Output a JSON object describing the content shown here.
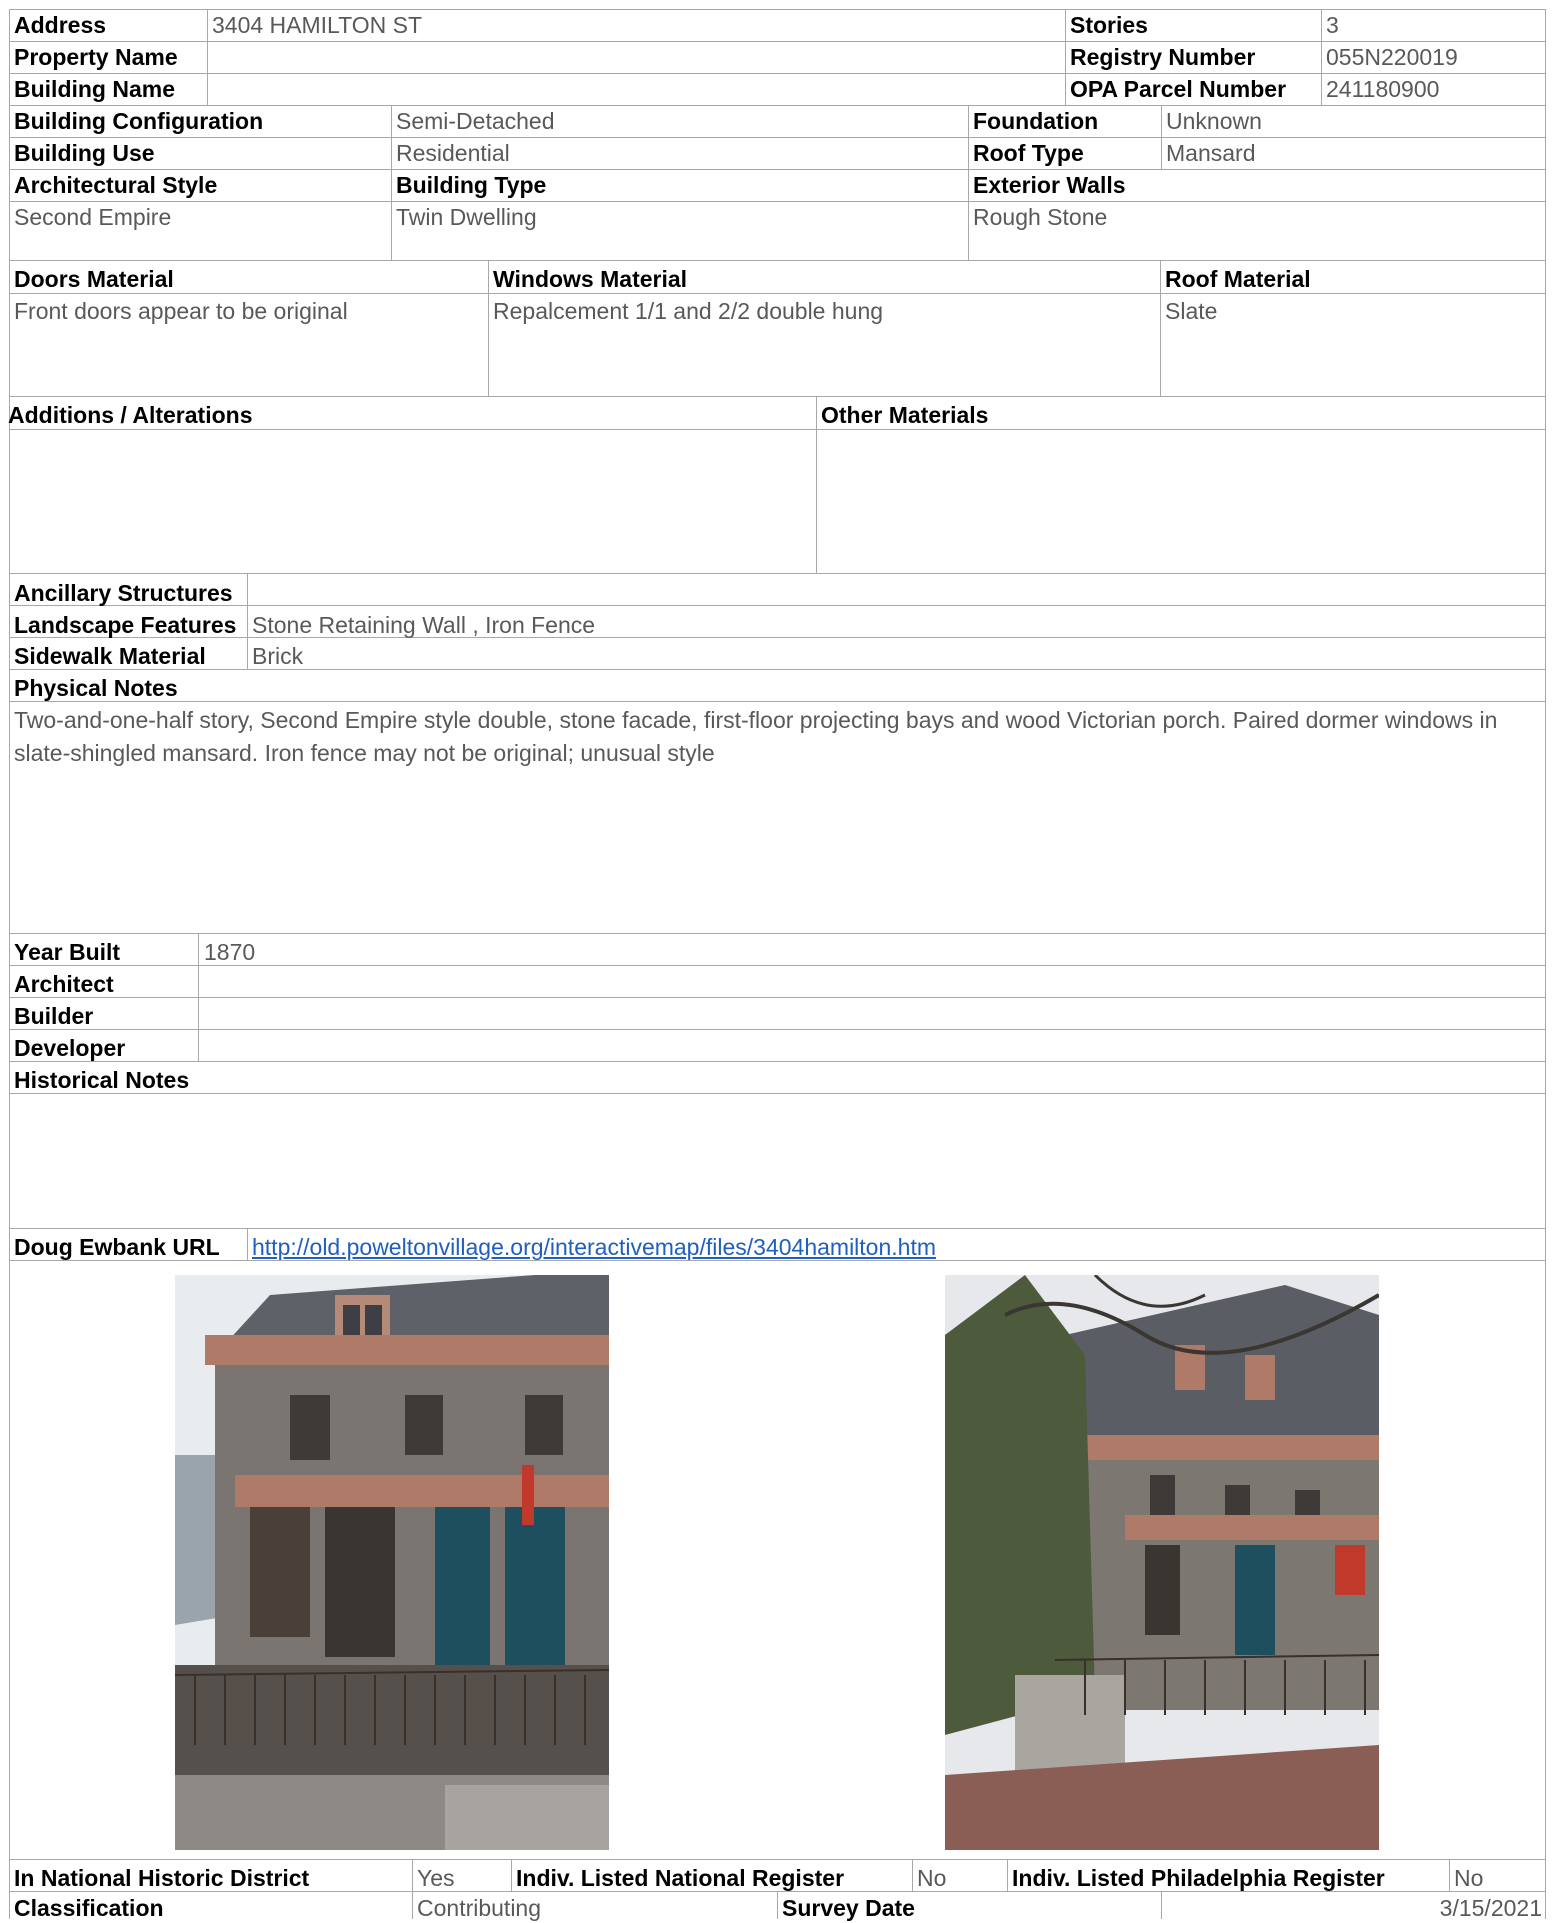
{
  "identity": {
    "address_label": "Address",
    "address_value": "3404 HAMILTON ST",
    "property_name_label": "Property Name",
    "property_name_value": "",
    "building_name_label": "Building Name",
    "building_name_value": "",
    "stories_label": "Stories",
    "stories_value": "3",
    "registry_label": "Registry Number",
    "registry_value": "055N220019",
    "opa_label": "OPA Parcel Number",
    "opa_value": "241180900"
  },
  "building": {
    "config_label": "Building Configuration",
    "config_value": "Semi-Detached",
    "use_label": "Building Use",
    "use_value": "Residential",
    "foundation_label": "Foundation",
    "foundation_value": "Unknown",
    "roof_type_label": "Roof Type",
    "roof_type_value": "Mansard",
    "style_label": "Architectural Style",
    "style_value": "Second Empire",
    "type_label": "Building Type",
    "type_value": "Twin Dwelling",
    "walls_label": "Exterior Walls",
    "walls_value": "Rough Stone"
  },
  "materials": {
    "doors_label": "Doors Material",
    "doors_value": "Front doors appear to be original",
    "windows_label": "Windows Material",
    "windows_value": "Repalcement 1/1 and 2/2 double hung",
    "roof_label": "Roof Material",
    "roof_value": "Slate",
    "additions_label": "Additions / Alterations",
    "additions_value": "",
    "other_label": "Other Materials",
    "other_value": ""
  },
  "site": {
    "ancillary_label": "Ancillary Structures",
    "ancillary_value": "",
    "landscape_label": "Landscape Features",
    "landscape_value": "Stone Retaining Wall , Iron Fence",
    "sidewalk_label": "Sidewalk Material",
    "sidewalk_value": "Brick",
    "physical_label": "Physical Notes",
    "physical_value": "Two-and-one-half story, Second Empire style double, stone facade, first-floor projecting bays and wood Victorian porch. Paired dormer windows in slate-shingled mansard. Iron fence may not be original; unusual style"
  },
  "history": {
    "year_label": "Year Built",
    "year_value": "1870",
    "architect_label": "Architect",
    "architect_value": "",
    "builder_label": "Builder",
    "builder_value": "",
    "developer_label": "Developer",
    "developer_value": "",
    "notes_label": "Historical Notes",
    "notes_value": "",
    "url_label": "Doug Ewbank URL",
    "url_value": "http://old.poweltonvillage.org/interactivemap/files/3404hamilton.htm"
  },
  "status": {
    "district_label": "In National Historic District",
    "district_value": "Yes",
    "national_label": "Indiv. Listed National Register",
    "national_value": "No",
    "philly_label": "Indiv. Listed Philadelphia Register",
    "philly_value": "No",
    "class_label": "Classification",
    "class_value": "Contributing",
    "survey_label": "Survey Date",
    "survey_value": "3/15/2021"
  },
  "colors": {
    "grid": "#a8a8a8",
    "value_text": "#595959",
    "link": "#1f5fbf",
    "stone": "#6d6a68",
    "trim": "#b07a68",
    "door": "#1e4f5e"
  }
}
